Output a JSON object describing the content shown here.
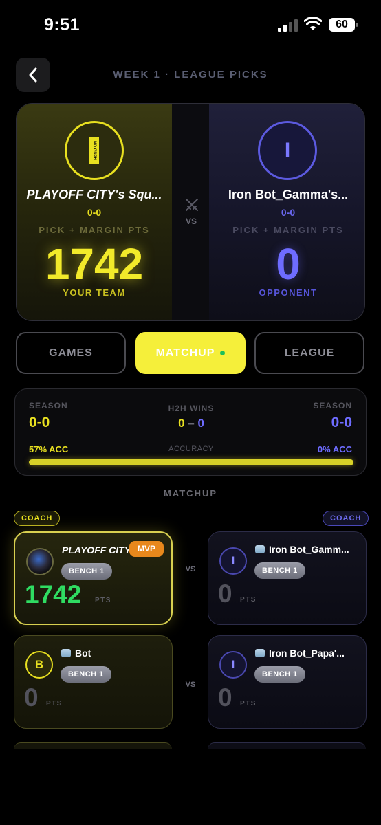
{
  "status_bar": {
    "time": "9:51",
    "battery": "60"
  },
  "header": {
    "title": "WEEK 1 · LEAGUE PICKS"
  },
  "scoreboard": {
    "left": {
      "name": "PLAYOFF CITY's Squ...",
      "record": "0-0",
      "pts_label": "PICK + MARGIN PTS",
      "score": "1742",
      "role": "YOUR TEAM",
      "badge_text": "NO GNPH"
    },
    "vs": "VS",
    "right": {
      "name": "Iron Bot_Gamma's...",
      "record": "0-0",
      "pts_label": "PICK + MARGIN PTS",
      "score": "0",
      "role": "OPPONENT",
      "badge_letter": "I"
    }
  },
  "tabs": [
    {
      "label": "GAMES",
      "active": false
    },
    {
      "label": "MATCHUP",
      "active": true
    },
    {
      "label": "LEAGUE",
      "active": false
    }
  ],
  "season_panel": {
    "left_label": "SEASON",
    "left_value": "0-0",
    "mid_label": "H2H WINS",
    "h2h_left": "0",
    "h2h_dash": "–",
    "h2h_right": "0",
    "right_label": "SEASON",
    "right_value": "0-0",
    "left_acc": "57% ACC",
    "mid_acc": "ACCURACY",
    "right_acc": "0% ACC"
  },
  "section": {
    "title": "MATCHUP"
  },
  "coach_left": "COACH",
  "coach_right": "COACH",
  "matchups": [
    {
      "left": {
        "name": "PLAYOFF CITY",
        "badge": "MVP",
        "bench": "BENCH 1",
        "score": "1742",
        "pts": "PTS"
      },
      "vs": "VS",
      "right": {
        "name": "Iron Bot_Gamm...",
        "letter": "I",
        "bench": "BENCH 1",
        "score": "0",
        "pts": "PTS"
      }
    },
    {
      "left": {
        "name": "Bot",
        "letter": "B",
        "bench": "BENCH 1",
        "score": "0",
        "pts": "PTS"
      },
      "vs": "VS",
      "right": {
        "name": "Iron Bot_Papa'...",
        "letter": "I",
        "bench": "BENCH 1",
        "score": "0",
        "pts": "PTS"
      }
    }
  ],
  "colors": {
    "accent_yellow": "#f5ef3a",
    "accent_blue": "#6e6cff",
    "score_green": "#2fdc62",
    "mvp_orange": "#e8881c"
  }
}
